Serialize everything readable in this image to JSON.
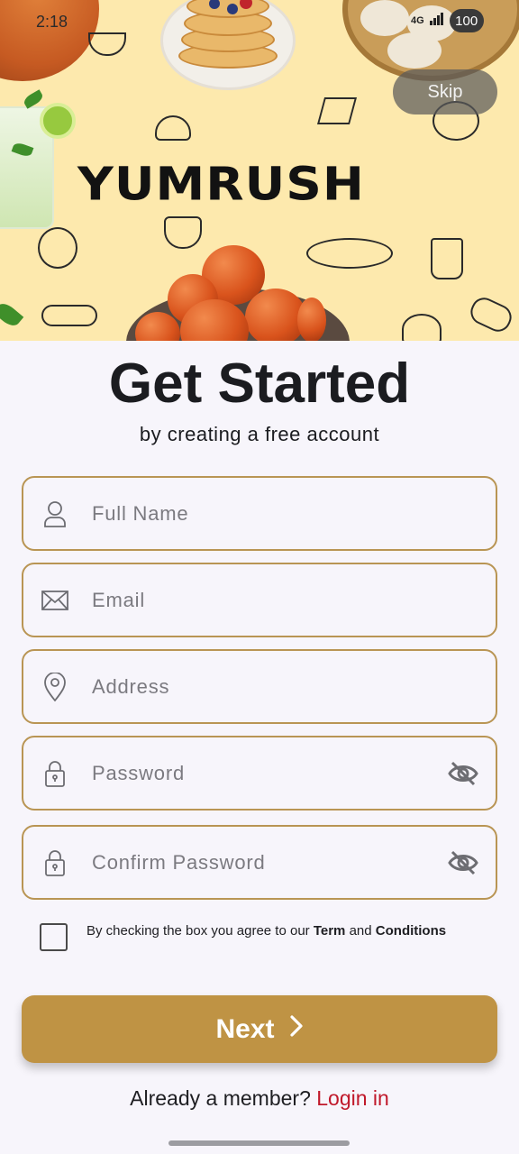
{
  "status_bar": {
    "time": "2:18",
    "network_label": "4G",
    "battery": "100"
  },
  "banner": {
    "brand": "YUMRUSH",
    "skip_label": "Skip"
  },
  "form": {
    "title": "Get Started",
    "subtitle": "by creating a free account",
    "fields": [
      {
        "placeholder": "Full Name",
        "icon": "user-icon"
      },
      {
        "placeholder": "Email",
        "icon": "mail-icon"
      },
      {
        "placeholder": "Address",
        "icon": "location-pin-icon"
      },
      {
        "placeholder": "Password",
        "icon": "lock-icon",
        "toggle_icon": "eye-off-icon"
      },
      {
        "placeholder": "Confirm Password",
        "icon": "lock-icon",
        "toggle_icon": "eye-off-icon"
      }
    ],
    "agreement": {
      "prefix": "By checking the box you agree to our ",
      "term": "Term",
      "conjunction": " and ",
      "conditions": "Conditions",
      "checked": false
    },
    "next_label": "Next",
    "login_prompt": "Already a member?",
    "login_link": "Login in"
  },
  "colors": {
    "banner_bg": "#fde9ad",
    "field_border": "#b99554",
    "next_button": "#bf9344",
    "login_link": "#c0182a"
  }
}
